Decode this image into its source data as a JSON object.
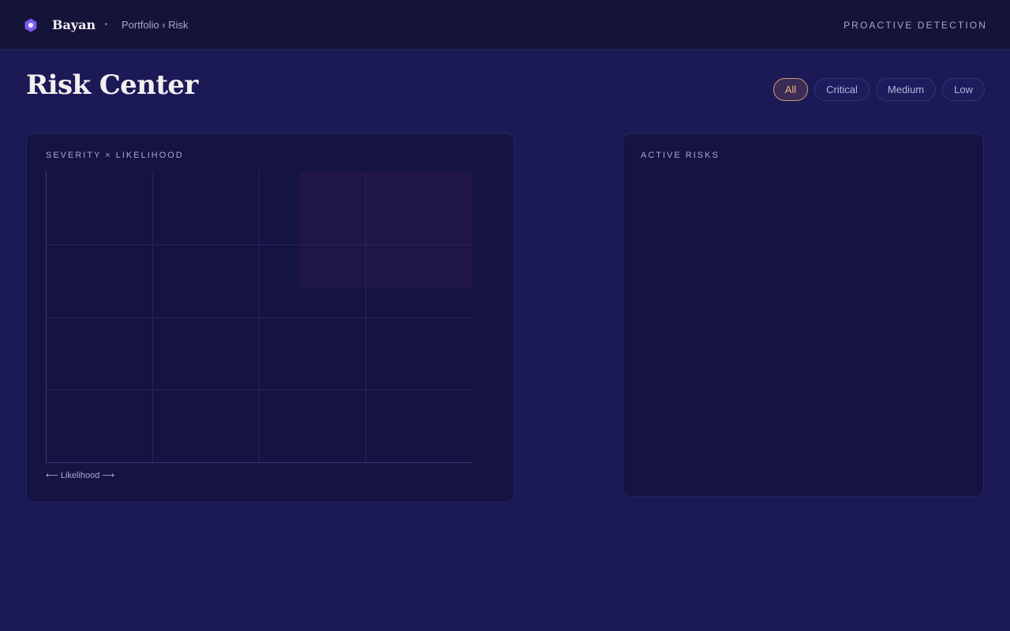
{
  "brand": {
    "name": "Bayan",
    "logo_icon": "hexagon-logo-icon"
  },
  "breadcrumb": "Portfolio › Risk",
  "header": {
    "right_label": "PROACTIVE DETECTION"
  },
  "page": {
    "title": "Risk Center"
  },
  "filters": [
    {
      "label": "All",
      "active": true
    },
    {
      "label": "Critical",
      "active": false
    },
    {
      "label": "Medium",
      "active": false
    },
    {
      "label": "Low",
      "active": false
    }
  ],
  "matrix_card": {
    "title": "SEVERITY × LIKELIHOOD",
    "axis_label": "⟵ Likelihood ⟶",
    "grid": {
      "columns": 4,
      "rows": 4
    },
    "critical_zone": {
      "columns": "3-4",
      "rows": "top 1.6"
    }
  },
  "risks_card": {
    "title": "ACTIVE RISKS",
    "items": []
  },
  "colors": {
    "background": "#1b1a57",
    "topbar": "#141338",
    "card": "#141342",
    "accent": "#eab17a",
    "logo": "#7b5cf0",
    "critical_zone": "#2a1a4a"
  }
}
